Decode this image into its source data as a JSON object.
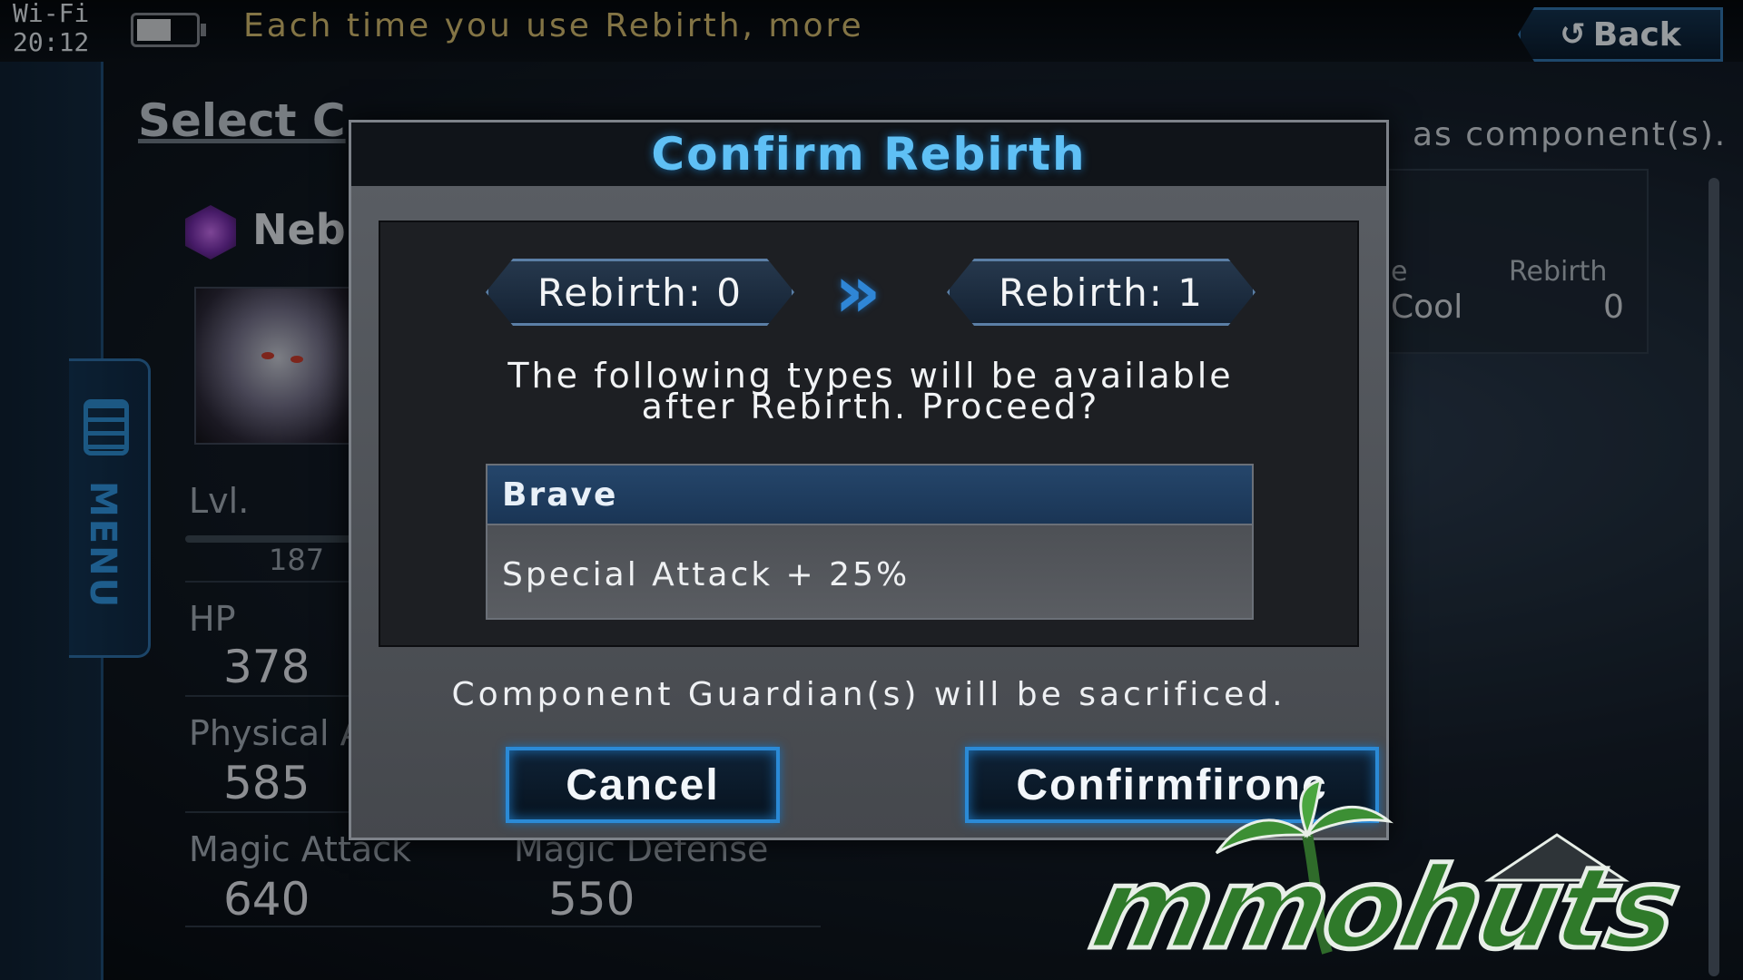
{
  "status_bar": {
    "network": "Wi-Fi",
    "time": "20:12",
    "battery_level": 0.6
  },
  "hint_text": "Each time you use Rebirth, more",
  "back_button": {
    "label": "Back",
    "icon": "refresh-arrow-icon"
  },
  "side_menu": {
    "label": "MENU",
    "icon": "menu-grid-icon"
  },
  "background": {
    "title": "Select Components",
    "title_partial": "Select C",
    "right_text": "as component(s).",
    "guardian_name_partial": "Nebu",
    "level_label": "Lvl.",
    "level_value": "187",
    "stats": [
      {
        "label": "HP",
        "value": "378"
      },
      {
        "label": "Physical Attack",
        "label_partial": "Physical A",
        "value": "585"
      },
      {
        "label": "Magic Attack",
        "value": "640"
      },
      {
        "label": "Magic Defense",
        "value": "550"
      }
    ],
    "panel": {
      "col1_label_partial": "e",
      "col1_value_partial": "Cool",
      "rebirth_label": "Rebirth",
      "rebirth_value": "0"
    }
  },
  "dialog": {
    "title": "Confirm Rebirth",
    "from_label": "Rebirth: 0",
    "to_label": "Rebirth: 1",
    "arrow": "»",
    "message_line1": "The following types will be available",
    "message_line2": "after Rebirth. Proceed?",
    "type_name": "Brave",
    "type_effect": "Special Attack + 25%",
    "sacrifice_notice": "Component Guardian(s) will be sacrificed.",
    "cancel_label": "Cancel",
    "confirm_label": "Confirmfironc"
  },
  "watermark": {
    "text": "mmohuts"
  },
  "colors": {
    "accent_blue": "#2f86d6",
    "title_cyan": "#5fc0f5",
    "hint_gold": "#c9b36a",
    "logo_green": "#2f7a2a"
  }
}
